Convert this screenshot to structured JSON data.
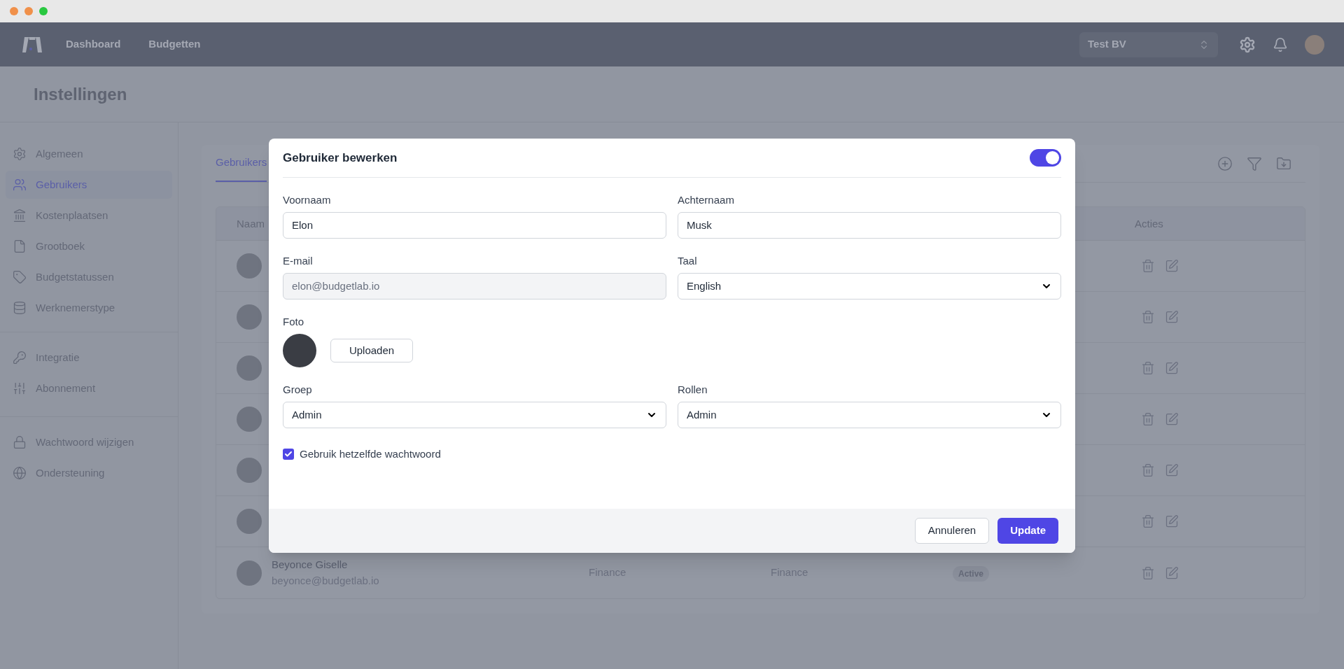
{
  "nav": {
    "links": [
      "Dashboard",
      "Budgetten"
    ],
    "company": "Test BV"
  },
  "page_title": "Instellingen",
  "sidebar": {
    "groups": [
      {
        "items": [
          {
            "label": "Algemeen",
            "selected": false
          },
          {
            "label": "Gebruikers",
            "selected": true
          },
          {
            "label": "Kostenplaatsen",
            "selected": false
          },
          {
            "label": "Grootboek",
            "selected": false
          },
          {
            "label": "Budgetstatussen",
            "selected": false
          },
          {
            "label": "Werknemerstype",
            "selected": false
          }
        ]
      },
      {
        "items": [
          {
            "label": "Integratie",
            "selected": false
          },
          {
            "label": "Abonnement",
            "selected": false
          }
        ]
      },
      {
        "items": [
          {
            "label": "Wachtwoord wijzigen",
            "selected": false
          },
          {
            "label": "Ondersteuning",
            "selected": false
          }
        ]
      }
    ]
  },
  "tabs": [
    {
      "label": "Gebruikers",
      "selected": true
    }
  ],
  "table": {
    "columns": [
      "Naam",
      "Acties"
    ],
    "rows": [
      {
        "kind": "covered"
      },
      {
        "kind": "covered"
      },
      {
        "kind": "covered"
      },
      {
        "kind": "covered"
      },
      {
        "kind": "covered"
      },
      {
        "kind": "covered"
      },
      {
        "kind": "full",
        "name": "Beyonce Giselle",
        "email": "beyonce@budgetlab.io",
        "group": "Finance",
        "role": "Finance",
        "status": "Active"
      }
    ]
  },
  "modal": {
    "title": "Gebruiker bewerken",
    "active": true,
    "fields": [
      {
        "label": "Voornaam",
        "value": "Elon",
        "kind": "text",
        "disabled": false
      },
      {
        "label": "Achternaam",
        "value": "Musk",
        "kind": "text",
        "disabled": false
      },
      {
        "label": "E-mail",
        "value": "elon@budgetlab.io",
        "kind": "text",
        "disabled": true
      },
      {
        "label": "Taal",
        "value": "English",
        "kind": "select",
        "disabled": false
      }
    ],
    "photo": {
      "label": "Foto",
      "button": "Uploaden"
    },
    "fields2": [
      {
        "label": "Groep",
        "value": "Admin",
        "kind": "select",
        "disabled": false
      },
      {
        "label": "Rollen",
        "value": "Admin",
        "kind": "select",
        "disabled": false
      }
    ],
    "same_password": {
      "label": "Gebruik hetzelfde wachtwoord",
      "checked": true
    },
    "buttons": {
      "cancel": "Annuleren",
      "submit": "Update"
    }
  }
}
